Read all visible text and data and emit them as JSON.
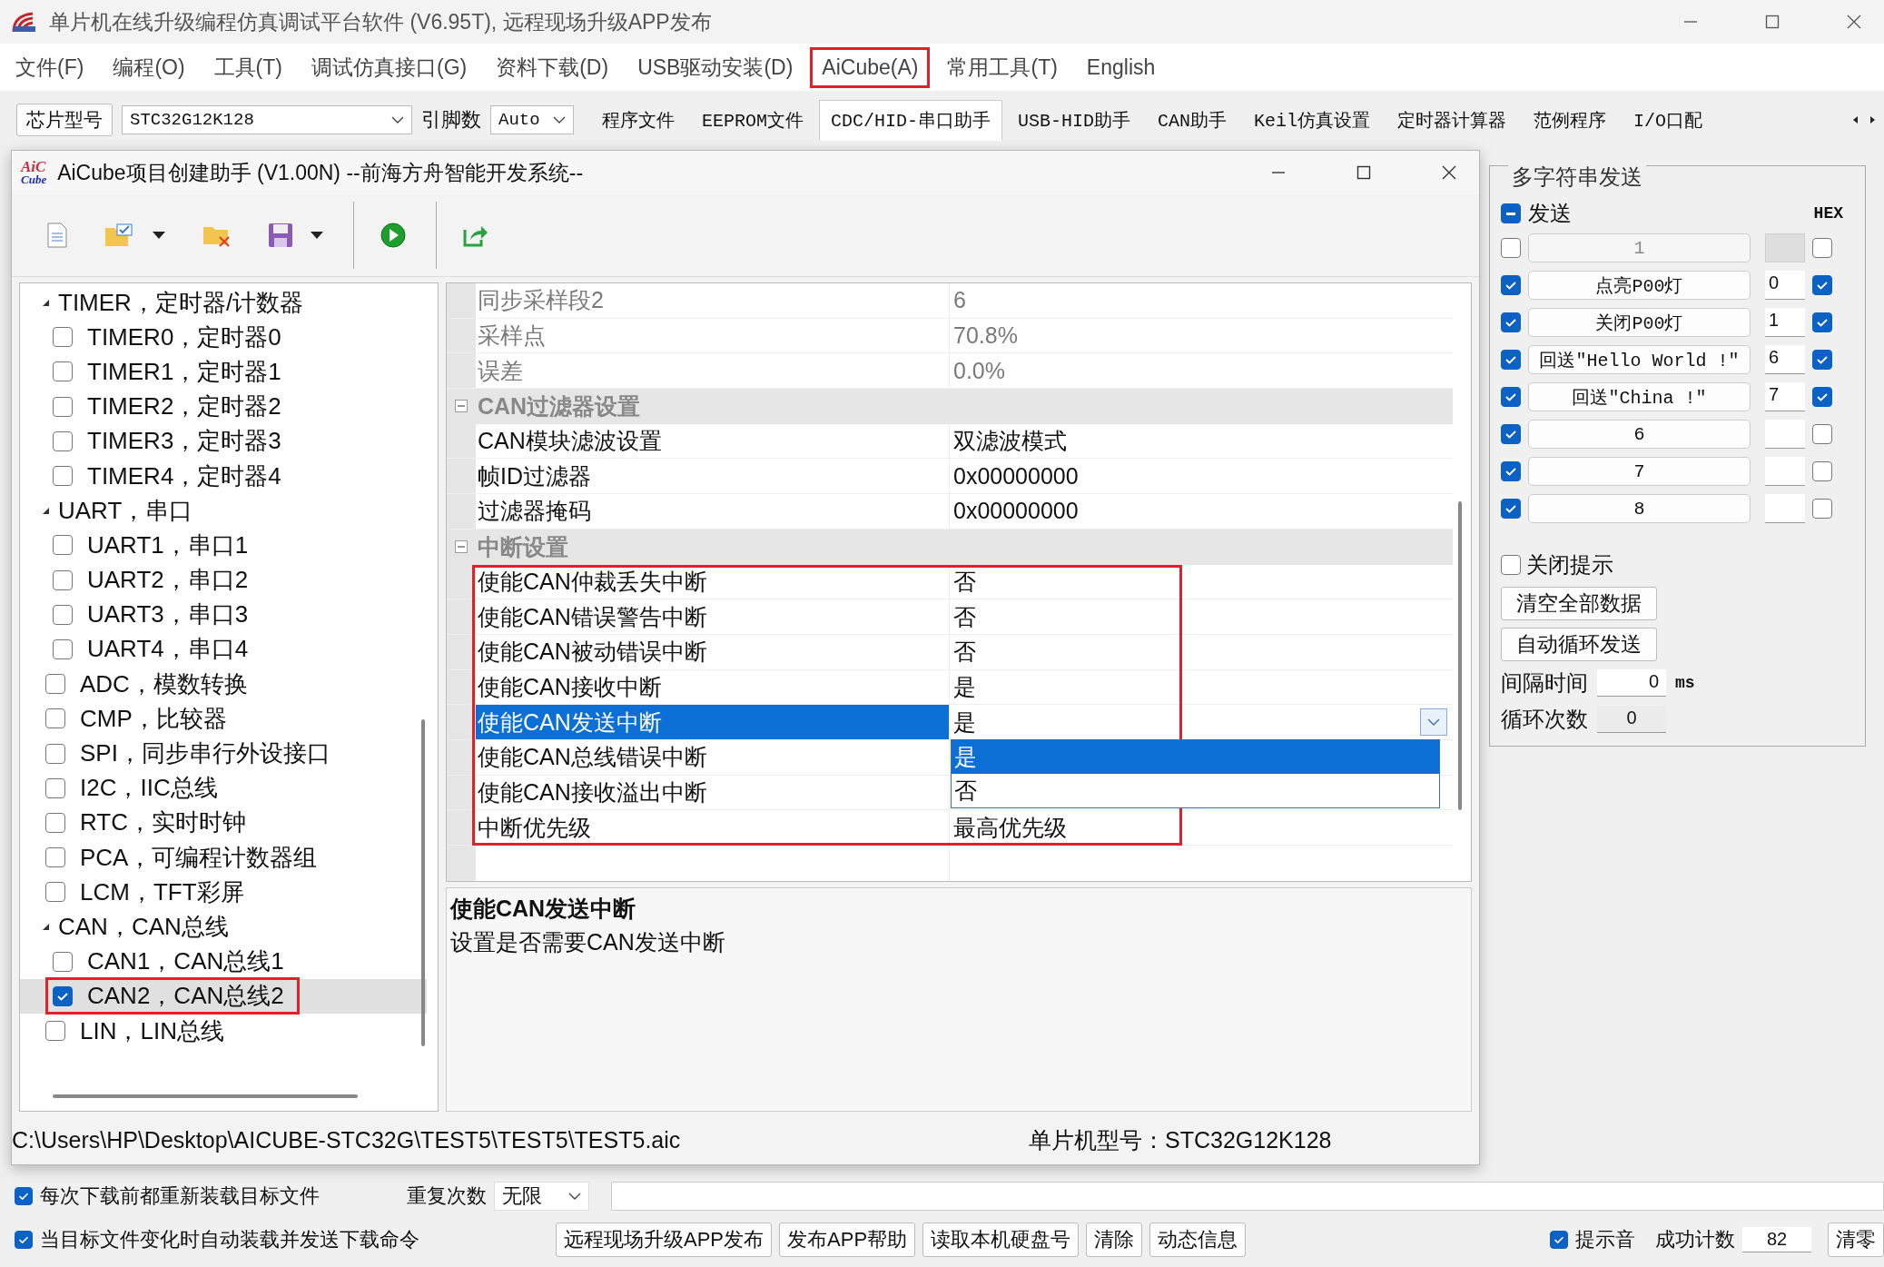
{
  "window": {
    "title": "单片机在线升级编程仿真调试平台软件 (V6.95T), 远程现场升级APP发布"
  },
  "menu": [
    {
      "label": "文件(F)",
      "highlighted": false
    },
    {
      "label": "编程(O)",
      "highlighted": false
    },
    {
      "label": "工具(T)",
      "highlighted": false
    },
    {
      "label": "调试仿真接口(G)",
      "highlighted": false
    },
    {
      "label": "资料下载(D)",
      "highlighted": false
    },
    {
      "label": "USB驱动安装(D)",
      "highlighted": false
    },
    {
      "label": "AiCube(A)",
      "highlighted": true
    },
    {
      "label": "常用工具(T)",
      "highlighted": false
    },
    {
      "label": "English",
      "highlighted": false
    }
  ],
  "toolbar": {
    "chip_button": "芯片型号",
    "chip_select": "STC32G12K128",
    "pins_label": "引脚数",
    "pins_select": "Auto",
    "tabs": [
      {
        "label": "程序文件",
        "selected": false
      },
      {
        "label": "EEPROM文件",
        "selected": false
      },
      {
        "label": "CDC/HID-串口助手",
        "selected": true
      },
      {
        "label": "USB-HID助手",
        "selected": false
      },
      {
        "label": "CAN助手",
        "selected": false
      },
      {
        "label": "Keil仿真设置",
        "selected": false
      },
      {
        "label": "定时器计算器",
        "selected": false
      },
      {
        "label": "范例程序",
        "selected": false
      },
      {
        "label": "I/O口配",
        "selected": false
      }
    ]
  },
  "dialog": {
    "logo_top": "AiC",
    "logo_bottom": "Cube",
    "title": "AiCube项目创建助手 (V1.00N) --前海方舟智能开发系统--",
    "tree": [
      {
        "kind": "group",
        "label": "TIMER，定时器/计数器",
        "expanded": true,
        "children": [
          {
            "kind": "item",
            "label": "TIMER0，定时器0",
            "checked": false,
            "selected": false,
            "highlighted": false
          },
          {
            "kind": "item",
            "label": "TIMER1，定时器1",
            "checked": false,
            "selected": false,
            "highlighted": false
          },
          {
            "kind": "item",
            "label": "TIMER2，定时器2",
            "checked": false,
            "selected": false,
            "highlighted": false
          },
          {
            "kind": "item",
            "label": "TIMER3，定时器3",
            "checked": false,
            "selected": false,
            "highlighted": false
          },
          {
            "kind": "item",
            "label": "TIMER4，定时器4",
            "checked": false,
            "selected": false,
            "highlighted": false
          }
        ]
      },
      {
        "kind": "group",
        "label": "UART，串口",
        "expanded": true,
        "children": [
          {
            "kind": "item",
            "label": "UART1，串口1",
            "checked": false,
            "selected": false,
            "highlighted": false
          },
          {
            "kind": "item",
            "label": "UART2，串口2",
            "checked": false,
            "selected": false,
            "highlighted": false
          },
          {
            "kind": "item",
            "label": "UART3，串口3",
            "checked": false,
            "selected": false,
            "highlighted": false
          },
          {
            "kind": "item",
            "label": "UART4，串口4",
            "checked": false,
            "selected": false,
            "highlighted": false
          }
        ]
      },
      {
        "kind": "item",
        "label": "ADC，模数转换",
        "checked": false,
        "selected": false,
        "highlighted": false
      },
      {
        "kind": "item",
        "label": "CMP，比较器",
        "checked": false,
        "selected": false,
        "highlighted": false
      },
      {
        "kind": "item",
        "label": "SPI，同步串行外设接口",
        "checked": false,
        "selected": false,
        "highlighted": false
      },
      {
        "kind": "item",
        "label": "I2C，IIC总线",
        "checked": false,
        "selected": false,
        "highlighted": false
      },
      {
        "kind": "item",
        "label": "RTC，实时时钟",
        "checked": false,
        "selected": false,
        "highlighted": false
      },
      {
        "kind": "item",
        "label": "PCA，可编程计数器组",
        "checked": false,
        "selected": false,
        "highlighted": false
      },
      {
        "kind": "item",
        "label": "LCM，TFT彩屏",
        "checked": false,
        "selected": false,
        "highlighted": false
      },
      {
        "kind": "group",
        "label": "CAN，CAN总线",
        "expanded": true,
        "children": [
          {
            "kind": "item",
            "label": "CAN1，CAN总线1",
            "checked": false,
            "selected": false,
            "highlighted": false
          },
          {
            "kind": "item",
            "label": "CAN2，CAN总线2",
            "checked": true,
            "selected": true,
            "highlighted": true
          }
        ]
      },
      {
        "kind": "item",
        "label": "LIN，LIN总线",
        "checked": false,
        "selected": false,
        "highlighted": false
      }
    ],
    "properties": [
      {
        "kind": "property",
        "name": "同步采样段2",
        "value": "6",
        "disabled": true,
        "selected": false
      },
      {
        "kind": "property",
        "name": "采样点",
        "value": "70.8%",
        "disabled": true,
        "selected": false
      },
      {
        "kind": "property",
        "name": "误差",
        "value": "0.0%",
        "disabled": true,
        "selected": false
      },
      {
        "kind": "category",
        "name": "CAN过滤器设置",
        "expanded": true,
        "children": [
          {
            "kind": "property",
            "name": "CAN模块滤波设置",
            "value": "双滤波模式",
            "disabled": false,
            "selected": false
          },
          {
            "kind": "property",
            "name": "帧ID过滤器",
            "value": "0x00000000",
            "disabled": false,
            "selected": false
          },
          {
            "kind": "property",
            "name": "过滤器掩码",
            "value": "0x00000000",
            "disabled": false,
            "selected": false
          }
        ]
      },
      {
        "kind": "category",
        "name": "中断设置",
        "expanded": true,
        "highlighted": true,
        "children": [
          {
            "kind": "property",
            "name": "使能CAN仲裁丢失中断",
            "value": "否",
            "disabled": false,
            "selected": false
          },
          {
            "kind": "property",
            "name": "使能CAN错误警告中断",
            "value": "否",
            "disabled": false,
            "selected": false
          },
          {
            "kind": "property",
            "name": "使能CAN被动错误中断",
            "value": "否",
            "disabled": false,
            "selected": false
          },
          {
            "kind": "property",
            "name": "使能CAN接收中断",
            "value": "是",
            "disabled": false,
            "selected": false
          },
          {
            "kind": "property",
            "name": "使能CAN发送中断",
            "value": "是",
            "disabled": false,
            "selected": true,
            "dropdown": {
              "options": [
                {
                  "label": "是",
                  "selected": true
                },
                {
                  "label": "否",
                  "selected": false
                }
              ]
            }
          },
          {
            "kind": "property",
            "name": "使能CAN总线错误中断",
            "disabled": false,
            "selected": false
          },
          {
            "kind": "property",
            "name": "使能CAN接收溢出中断",
            "disabled": false,
            "selected": false
          },
          {
            "kind": "property",
            "name": "中断优先级",
            "value": "最高优先级",
            "disabled": false,
            "selected": false
          }
        ]
      }
    ],
    "description": {
      "title": "使能CAN发送中断",
      "text": "设置是否需要CAN发送中断"
    },
    "status": {
      "path": "C:\\Users\\HP\\Desktop\\AICUBE-STC32G\\TEST5\\TEST5\\TEST5.aic",
      "chip": "单片机型号：STC32G12K128"
    }
  },
  "multi_send": {
    "title": "多字符串发送",
    "send_all": {
      "label": "发送",
      "indeterminate": true
    },
    "hex_label": "HEX",
    "rows": [
      {
        "enabled": false,
        "disabled": true,
        "label": "1",
        "hex": false
      },
      {
        "enabled": true,
        "disabled": false,
        "label": "点亮P00灯",
        "code": "0",
        "hex": true
      },
      {
        "enabled": true,
        "disabled": false,
        "label": "关闭P00灯",
        "code": "1",
        "hex": true
      },
      {
        "enabled": true,
        "disabled": false,
        "label": "回送\"Hello World !\"",
        "code": "6",
        "hex": true
      },
      {
        "enabled": true,
        "disabled": false,
        "label": "回送\"China !\"",
        "code": "7",
        "hex": true
      },
      {
        "enabled": true,
        "disabled": false,
        "label": "6",
        "hex": false
      },
      {
        "enabled": true,
        "disabled": false,
        "label": "7",
        "hex": false
      },
      {
        "enabled": true,
        "disabled": false,
        "label": "8",
        "hex": false
      }
    ],
    "close_hint": {
      "label": "关闭提示",
      "checked": false
    },
    "buttons": [
      "清空全部数据",
      "自动循环发送"
    ],
    "interval": {
      "label": "间隔时间",
      "value": "0",
      "unit": "ms"
    },
    "loop_count": {
      "label": "循环次数",
      "value": "0"
    }
  },
  "bottom": {
    "reload_each": {
      "label": "每次下载前都重新装载目标文件",
      "checked": true
    },
    "auto_reload": {
      "label": "当目标文件变化时自动装载并发送下载命令",
      "checked": true
    },
    "repeat_label": "重复次数",
    "repeat_select": "无限",
    "buttons": [
      "远程现场升级APP发布",
      "发布APP帮助",
      "读取本机硬盘号",
      "清除",
      "动态信息"
    ],
    "beep": {
      "label": "提示音",
      "checked": true
    },
    "success_label": "成功计数",
    "success_value": "82",
    "reset_button": "清零"
  }
}
